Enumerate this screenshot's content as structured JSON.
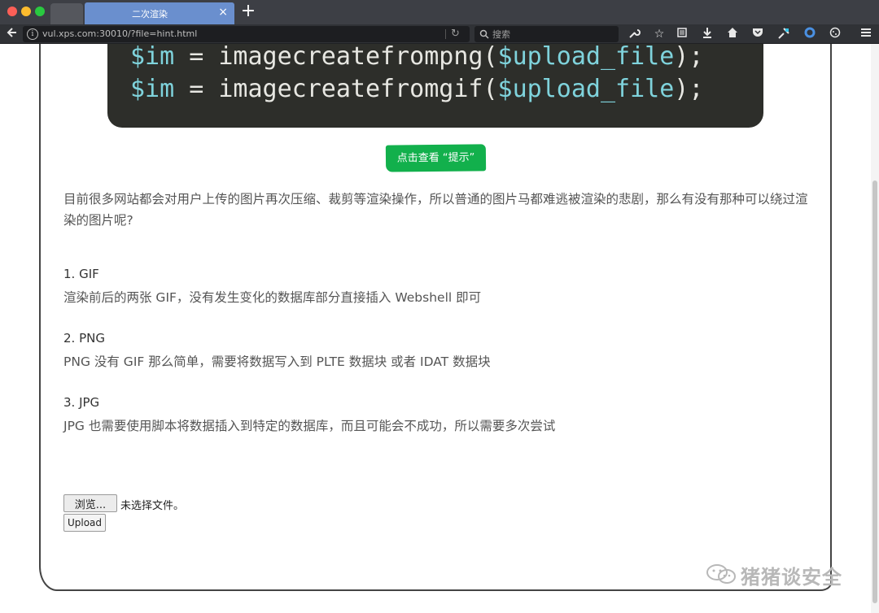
{
  "browser": {
    "tab_title": "二次渲染",
    "tab_close": "×",
    "new_tab": "+",
    "url": "vul.xps.com:30010/?file=hint.html",
    "search_placeholder": "搜索"
  },
  "page": {
    "code_lines": [
      {
        "prefix": "",
        "var": "$im",
        "middle": " = imagecreatefrompng(",
        "var2": "$upload_file",
        "suffix": ");"
      },
      {
        "prefix": "",
        "var": "$im",
        "middle": " = imagecreatefromgif(",
        "var2": "$upload_file",
        "suffix": ");"
      }
    ],
    "hint_button": "点击查看 “提示”",
    "intro": "目前很多网站都会对用户上传的图片再次压缩、裁剪等渲染操作，所以普通的图片马都难逃被渲染的悲剧，那么有没有那种可以绕过渲染的图片呢?",
    "sections": [
      {
        "title": "1. GIF",
        "body": "渲染前后的两张 GIF，没有发生变化的数据库部分直接插入 Webshell 即可"
      },
      {
        "title": "2. PNG",
        "body": "PNG 没有 GIF 那么简单，需要将数据写入到 PLTE 数据块 或者 IDAT 数据块"
      },
      {
        "title": "3. JPG",
        "body": "JPG 也需要使用脚本将数据插入到特定的数据库，而且可能会不成功，所以需要多次尝试"
      }
    ],
    "file_input": {
      "browse_label": "浏览...",
      "status": "未选择文件。"
    },
    "upload_label": "Upload",
    "watermark": "猪猪谈安全"
  },
  "colors": {
    "hint_button": "#12b04c",
    "tab_active": "#6a8fce",
    "code_bg": "#2d2e2a"
  }
}
